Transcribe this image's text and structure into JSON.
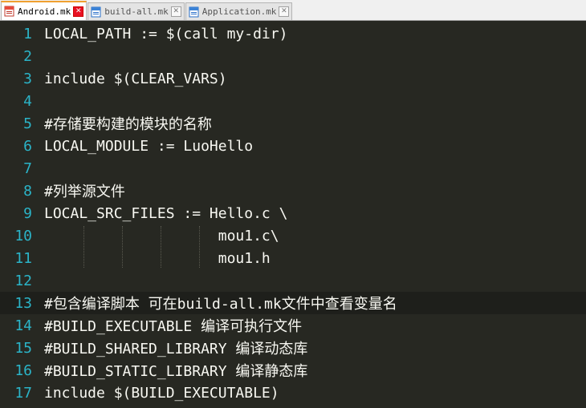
{
  "tabs": [
    {
      "label": "Android.mk",
      "active": true,
      "icon": "file-icon"
    },
    {
      "label": "build-all.mk",
      "active": false,
      "icon": "file-icon"
    },
    {
      "label": "Application.mk",
      "active": false,
      "icon": "file-icon"
    }
  ],
  "tab_close_glyph": "✕",
  "colors": {
    "background": "#272822",
    "line_number": "#2bb4c8",
    "code_text": "#f8f8f2",
    "comment": "#4ec94e",
    "active_tab_accent": "#f0a030",
    "close_button_active": "#e81123"
  },
  "current_line": 13,
  "lines": [
    {
      "n": "1",
      "text": "LOCAL_PATH := $(call my-dir)",
      "kind": "code"
    },
    {
      "n": "2",
      "text": "",
      "kind": "code"
    },
    {
      "n": "3",
      "text": "include $(CLEAR_VARS)",
      "kind": "code"
    },
    {
      "n": "4",
      "text": "",
      "kind": "code"
    },
    {
      "n": "5",
      "text": "#存储要构建的模块的名称",
      "kind": "comment"
    },
    {
      "n": "6",
      "text": "LOCAL_MODULE := LuoHello",
      "kind": "code"
    },
    {
      "n": "7",
      "text": "",
      "kind": "code"
    },
    {
      "n": "8",
      "text": "#列举源文件",
      "kind": "comment"
    },
    {
      "n": "9",
      "text": "LOCAL_SRC_FILES := Hello.c \\",
      "kind": "code"
    },
    {
      "n": "10",
      "text": "                    mou1.c\\",
      "kind": "code"
    },
    {
      "n": "11",
      "text": "                    mou1.h",
      "kind": "code"
    },
    {
      "n": "12",
      "text": "",
      "kind": "code"
    },
    {
      "n": "13",
      "text": "#包含编译脚本 可在build-all.mk文件中查看变量名",
      "kind": "comment"
    },
    {
      "n": "14",
      "text": "#BUILD_EXECUTABLE 编译可执行文件",
      "kind": "comment"
    },
    {
      "n": "15",
      "text": "#BUILD_SHARED_LIBRARY 编译动态库",
      "kind": "comment"
    },
    {
      "n": "16",
      "text": "#BUILD_STATIC_LIBRARY 编译静态库",
      "kind": "comment"
    },
    {
      "n": "17",
      "text": "include $(BUILD_EXECUTABLE)",
      "kind": "code"
    }
  ]
}
